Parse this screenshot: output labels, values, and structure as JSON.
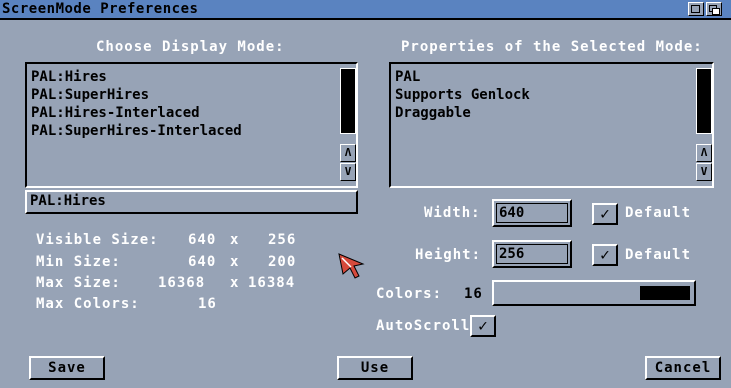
{
  "window": {
    "title": "ScreenMode Preferences"
  },
  "left": {
    "heading": "Choose Display Mode:",
    "modes": [
      "PAL:Hires",
      "PAL:SuperHires",
      "PAL:Hires-Interlaced",
      "PAL:SuperHires-Interlaced"
    ],
    "selected": "PAL:Hires",
    "info": [
      {
        "label": "Visible Size:",
        "a": "640",
        "x": "x",
        "b": "256"
      },
      {
        "label": "Min Size:",
        "a": "640",
        "x": "x",
        "b": "200"
      },
      {
        "label": "Max Size:",
        "a": "16368",
        "x": "x",
        "b": "16384"
      },
      {
        "label": "Max Colors:",
        "a": "16"
      }
    ]
  },
  "right": {
    "heading": "Properties of the Selected Mode:",
    "properties": [
      "PAL",
      "Supports Genlock",
      "Draggable"
    ],
    "width_label": "Width:",
    "width_value": "640",
    "height_label": "Height:",
    "height_value": "256",
    "default_label": "Default",
    "colors_label": "Colors:",
    "colors_value": "16",
    "colors_level": 1.0,
    "autoscroll_label": "AutoScroll:",
    "check_glyph": "✓"
  },
  "scroll": {
    "up": "Λ",
    "down": "V"
  },
  "buttons": {
    "save": "Save",
    "use": "Use",
    "cancel": "Cancel"
  }
}
